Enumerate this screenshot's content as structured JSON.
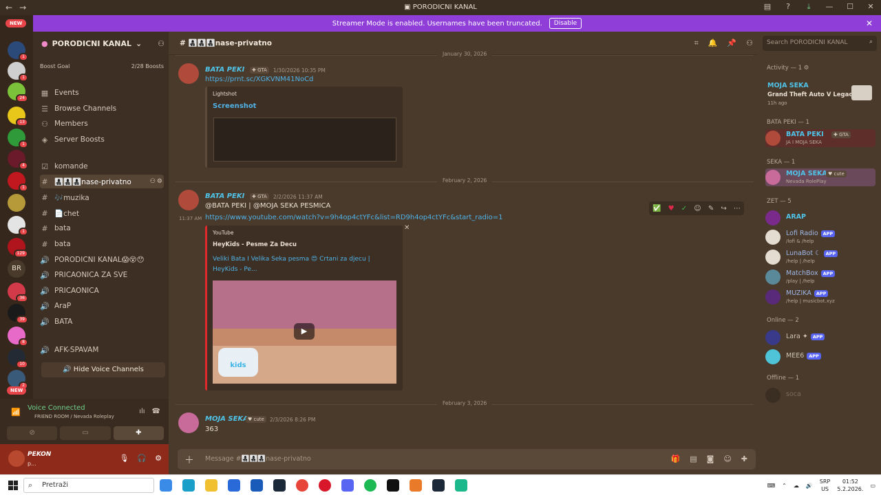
{
  "window": {
    "title": "PORODICNI KANAL"
  },
  "banner": {
    "text": "Streamer Mode is enabled. Usernames have been truncated.",
    "button": "Disable"
  },
  "rail": {
    "new_label": "NEW",
    "new_label_bottom": "NEW",
    "text_server": "BR",
    "badges": [
      "1",
      "1",
      "24",
      "13",
      "1",
      "4",
      "1",
      "1",
      "129",
      "36",
      "39",
      "8",
      "10",
      "2"
    ]
  },
  "guild": {
    "name": "PORODICNI KANAL",
    "boost_label": "Boost Goal",
    "boost_count": "2/28 Boosts",
    "menu": [
      "Events",
      "Browse Channels",
      "Members",
      "Server Boosts"
    ],
    "channels": [
      {
        "icon": "checkbox",
        "name": "komande"
      },
      {
        "icon": "#",
        "name": "👩‍👧‍👦👩‍👧‍👦👩‍👧‍👦nase-privatno",
        "active": true
      },
      {
        "icon": "#",
        "name": "🎶muzika"
      },
      {
        "icon": "#",
        "name": "📄chet"
      },
      {
        "icon": "#",
        "name": "bata"
      },
      {
        "icon": "#",
        "name": "bata"
      },
      {
        "icon": "speaker",
        "name": "PORODICNI KANAL😱😵😯"
      },
      {
        "icon": "speaker",
        "name": "PRICAONICA ZA SVE"
      },
      {
        "icon": "speaker",
        "name": "PRICAONICA"
      },
      {
        "icon": "speaker",
        "name": "AraP"
      },
      {
        "icon": "speaker",
        "name": "BATA"
      },
      {
        "icon": "speaker",
        "name": "AFK-SPAVAM"
      }
    ],
    "hide_voice": "Hide Voice Channels"
  },
  "voice": {
    "title": "Voice Connected",
    "sub": "FRIEND ROOM / Nevada Roleplay"
  },
  "user": {
    "name": "PEKON",
    "status": "p..."
  },
  "chat": {
    "channel": "👩‍👧‍👦👩‍👧‍👦👩‍👧‍👦nase-privatno",
    "search_placeholder": "Search PORODICNI KANAL",
    "dividers": [
      "January 30, 2026",
      "February 2, 2026",
      "February 3, 2026"
    ],
    "messages": [
      {
        "author": "BATA PEKI",
        "tag": "GTA",
        "time": "1/30/2026 10:35 PM",
        "link": "https://prnt.sc/XGKVNM41NoCd",
        "embed_provider": "Lightshot",
        "embed_title": "Screenshot"
      },
      {
        "author": "BATA PEKI",
        "tag": "GTA",
        "time": "2/2/2026 11:37 AM",
        "side_time": "11:37 AM",
        "text": "@BATA PEKI  | @MOJA SEKA  PESMICA",
        "link": "https://www.youtube.com/watch?v=9h4op4ctYFc&list=RD9h4op4ctYFc&start_radio=1",
        "embed_provider": "YouTube",
        "embed_author": "HeyKids - Pesme Za Decu",
        "embed_title": "Veliki Bata I Velika Seka pesma 😍 Crtani za djecu | HeyKids - Pe..."
      },
      {
        "author": "MOJA SEKA",
        "tag": "cute",
        "time": "2/3/2026 8:26 PM",
        "text": "363"
      }
    ],
    "composer_placeholder": "Message #👩‍👧‍👦👩‍👧‍👦👩‍👧‍👦nase-privatno"
  },
  "members": {
    "activity": {
      "header": "Activity — 1",
      "name": "MOJA SEKA",
      "game": "Grand Theft Auto V Legacy",
      "ago": "11h ago"
    },
    "groups": [
      {
        "header": "BATA PEKI — 1",
        "members": [
          {
            "name": "BATA PEKI",
            "tag": "GTA",
            "sub": "JA I MOJA SEKA"
          }
        ]
      },
      {
        "header": "SEKA — 1",
        "members": [
          {
            "name": "MOJA SEKA",
            "tag": "cute",
            "sub": "Nevada RolePlay"
          }
        ]
      },
      {
        "header": "ZET — 5",
        "members": [
          {
            "name": "ARAP"
          },
          {
            "name": "Lofi Radio",
            "app": "APP",
            "sub": "/lofi & /help"
          },
          {
            "name": "LunaBot",
            "app": "APP",
            "sub": "/help | /help"
          },
          {
            "name": "MatchBox",
            "app": "APP",
            "sub": "/play | /help"
          },
          {
            "name": "MUZIKA",
            "app": "APP",
            "sub": "/help | musicbot.xyz"
          }
        ]
      },
      {
        "header": "Online — 2",
        "members": [
          {
            "name": "Lara",
            "app": "APP"
          },
          {
            "name": "MEE6",
            "app": "APP"
          }
        ]
      },
      {
        "header": "Offline — 1",
        "members": [
          {
            "name": "soca"
          }
        ]
      }
    ]
  },
  "taskbar": {
    "search": "Pretraži",
    "lang_top": "SRP",
    "lang_bottom": "US",
    "time": "01:52",
    "date": "5.2.2026."
  }
}
